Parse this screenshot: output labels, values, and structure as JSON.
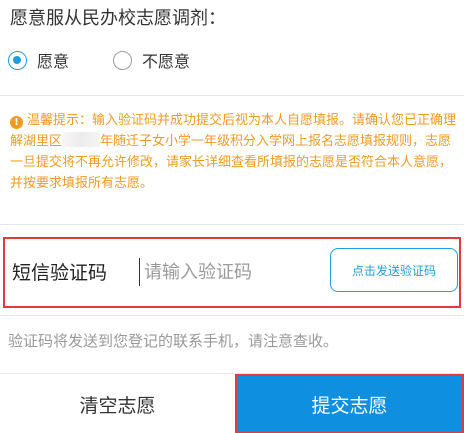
{
  "question": {
    "label": "愿意服从民办校志愿调剂："
  },
  "options": [
    {
      "label": "愿意",
      "selected": true
    },
    {
      "label": "不愿意",
      "selected": false
    }
  ],
  "notice": {
    "icon": "info-icon",
    "part1": "温馨提示：输入验证码并成功提交后视为本人自愿填报。请确认您已正确理解湖里区",
    "part2": "年随迁子女小学一年级积分入学网上报名志愿填报规则，志愿一旦提交将不再允许修改，请家长详细查看所填报的志愿是否符合本人意愿，并按要求填报所有志愿。"
  },
  "code": {
    "label": "短信验证码",
    "placeholder": "请输入验证码",
    "send_label": "点击发送验证码"
  },
  "hint": "验证码将发送到您登记的联系手机，请注意查收。",
  "actions": {
    "clear_label": "清空志愿",
    "submit_label": "提交志愿"
  },
  "colors": {
    "accent": "#1e9fdb",
    "warning": "#f39a21",
    "highlight": "#e23b3b",
    "submit_bg": "#0f8fe0"
  }
}
